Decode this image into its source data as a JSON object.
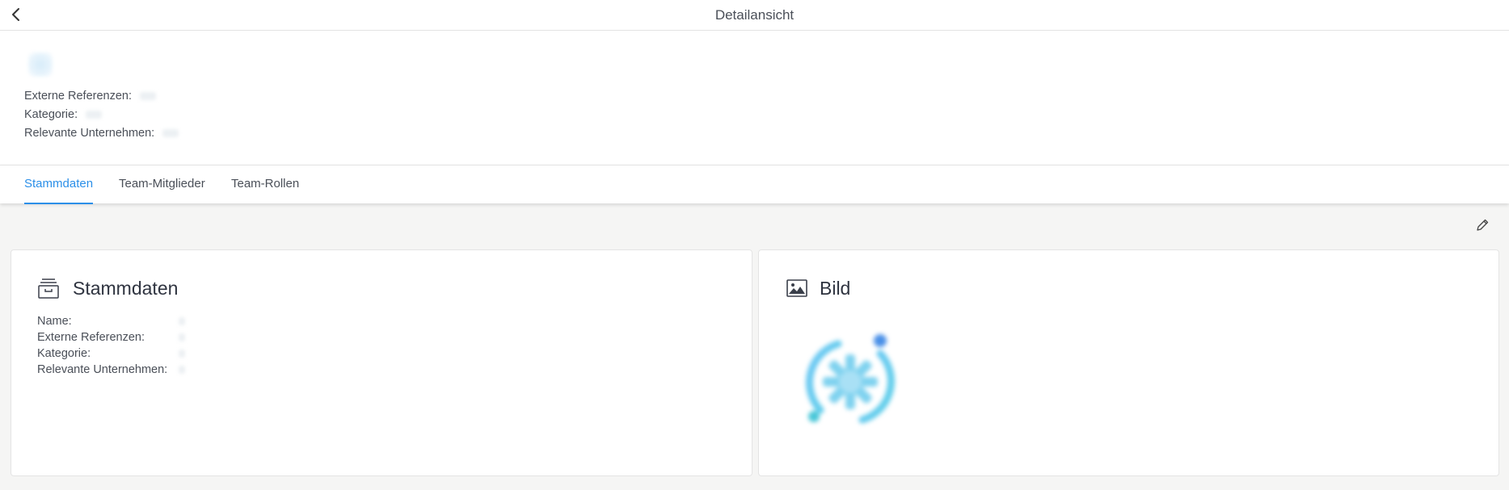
{
  "topbar": {
    "title": "Detailansicht"
  },
  "header": {
    "fields": [
      {
        "label": "Externe Referenzen:"
      },
      {
        "label": "Kategorie:"
      },
      {
        "label": "Relevante Unternehmen:"
      }
    ]
  },
  "tabs": [
    {
      "label": "Stammdaten",
      "active": true
    },
    {
      "label": "Team-Mitglieder",
      "active": false
    },
    {
      "label": "Team-Rollen",
      "active": false
    }
  ],
  "cards": {
    "stammdaten": {
      "title": "Stammdaten",
      "icon": "archive-icon",
      "fields": [
        {
          "label": "Name:"
        },
        {
          "label": "Externe Referenzen:"
        },
        {
          "label": "Kategorie:"
        },
        {
          "label": "Relevante Unternehmen:"
        }
      ]
    },
    "bild": {
      "title": "Bild",
      "icon": "image-icon"
    }
  },
  "colors": {
    "accent": "#2b8fe8",
    "background": "#f5f5f4"
  }
}
